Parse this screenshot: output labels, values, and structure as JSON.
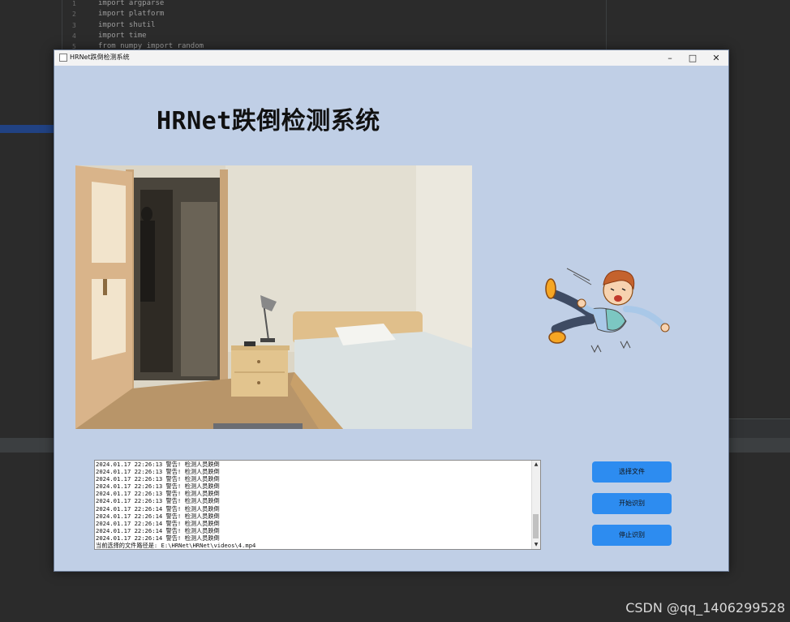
{
  "ide": {
    "line_numbers": [
      "1",
      "2",
      "3",
      "4",
      "5"
    ],
    "code_lines": [
      "import argparse",
      "import platform",
      "import shutil",
      "import time",
      "from numpy import random"
    ]
  },
  "window": {
    "title": "HRNet跌倒检测系统",
    "controls": {
      "minimize": "–",
      "maximize": "□",
      "close": "✕"
    }
  },
  "app": {
    "heading": "HRNet跌倒检测系统",
    "log_lines": [
      "2024.01.17 22:26:13 警告! 检测人员跌倒",
      "2024.01.17 22:26:13 警告! 检测人员跌倒",
      "2024.01.17 22:26:13 警告! 检测人员跌倒",
      "2024.01.17 22:26:13 警告! 检测人员跌倒",
      "2024.01.17 22:26:13 警告! 检测人员跌倒",
      "2024.01.17 22:26:13 警告! 检测人员跌倒",
      "2024.01.17 22:26:14 警告! 检测人员跌倒",
      "2024.01.17 22:26:14 警告! 检测人员跌倒",
      "2024.01.17 22:26:14 警告! 检测人员跌倒",
      "2024.01.17 22:26:14 警告! 检测人员跌倒",
      "2024.01.17 22:26:14 警告! 检测人员跌倒",
      "当前选择的文件路径是: E:\\HRNet\\HRNet\\videos\\4.mp4"
    ],
    "buttons": {
      "select_file": "选择文件",
      "start_detect": "开始识别",
      "stop_detect": "停止识别"
    },
    "colors": {
      "window_bg": "#c0cfe6",
      "button": "#2d8cf0"
    }
  },
  "watermark": "CSDN @qq_1406299528"
}
